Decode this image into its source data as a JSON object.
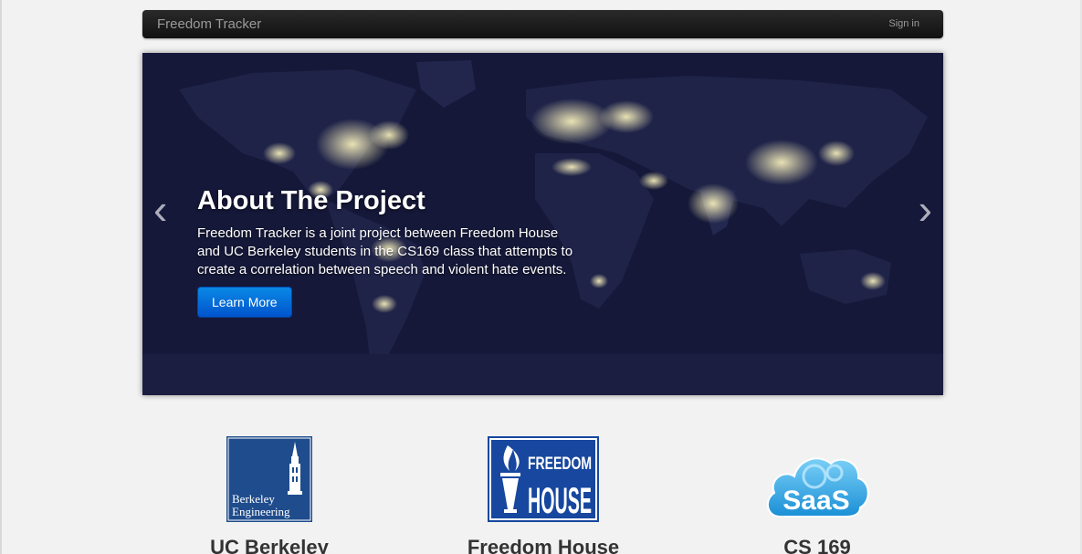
{
  "navbar": {
    "brand": "Freedom Tracker",
    "signin": "Sign in"
  },
  "carousel": {
    "prev_icon": "chevron-left-icon",
    "next_icon": "chevron-right-icon",
    "prev_glyph": "‹",
    "next_glyph": "›",
    "title": "About The Project",
    "text": "Freedom Tracker is a joint project between Freedom House and UC Berkeley students in the CS169 class that attempts to create a correlation between speech and violent hate events.",
    "button": "Learn More"
  },
  "partners": [
    {
      "name": "UC Berkeley",
      "logo_text_1": "Berkeley",
      "logo_text_2": "Engineering"
    },
    {
      "name": "Freedom House",
      "logo_text_1": "FREEDOM",
      "logo_text_2": "HOUSE"
    },
    {
      "name": "CS 169",
      "logo_text_1": "SaaS"
    }
  ],
  "colors": {
    "navbar": "#1b1b1b",
    "page_background": "#f2f2f2",
    "map_background": "#141733",
    "button": "#0a6fd6",
    "berkeley_blue": "#1f4c8c",
    "freedom_house_blue": "#17479e",
    "saas_blue": "#2aa7e6"
  }
}
